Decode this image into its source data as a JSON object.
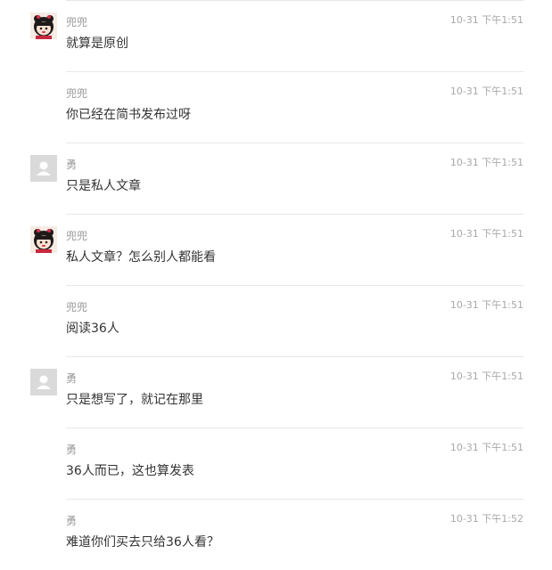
{
  "messages": [
    {
      "sender": "兜兜",
      "time": "10-31 下午1:51",
      "text": "就算是原创",
      "avatar": "anime-girl-avatar"
    },
    {
      "sender": "兜兜",
      "time": "10-31 下午1:51",
      "text": "你已经在简书发布过呀",
      "avatar": "none"
    },
    {
      "sender": "勇",
      "time": "10-31 下午1:51",
      "text": "只是私人文章",
      "avatar": "default-user-avatar"
    },
    {
      "sender": "兜兜",
      "time": "10-31 下午1:51",
      "text": "私人文章？怎么别人都能看",
      "avatar": "anime-girl-avatar"
    },
    {
      "sender": "兜兜",
      "time": "10-31 下午1:51",
      "text": "阅读36人",
      "avatar": "none"
    },
    {
      "sender": "勇",
      "time": "10-31 下午1:51",
      "text": "只是想写了，就记在那里",
      "avatar": "default-user-avatar"
    },
    {
      "sender": "勇",
      "time": "10-31 下午1:51",
      "text": "36人而已，这也算发表",
      "avatar": "none"
    },
    {
      "sender": "勇",
      "time": "10-31 下午1:52",
      "text": "难道你们买去只给36人看？",
      "avatar": "none"
    }
  ]
}
